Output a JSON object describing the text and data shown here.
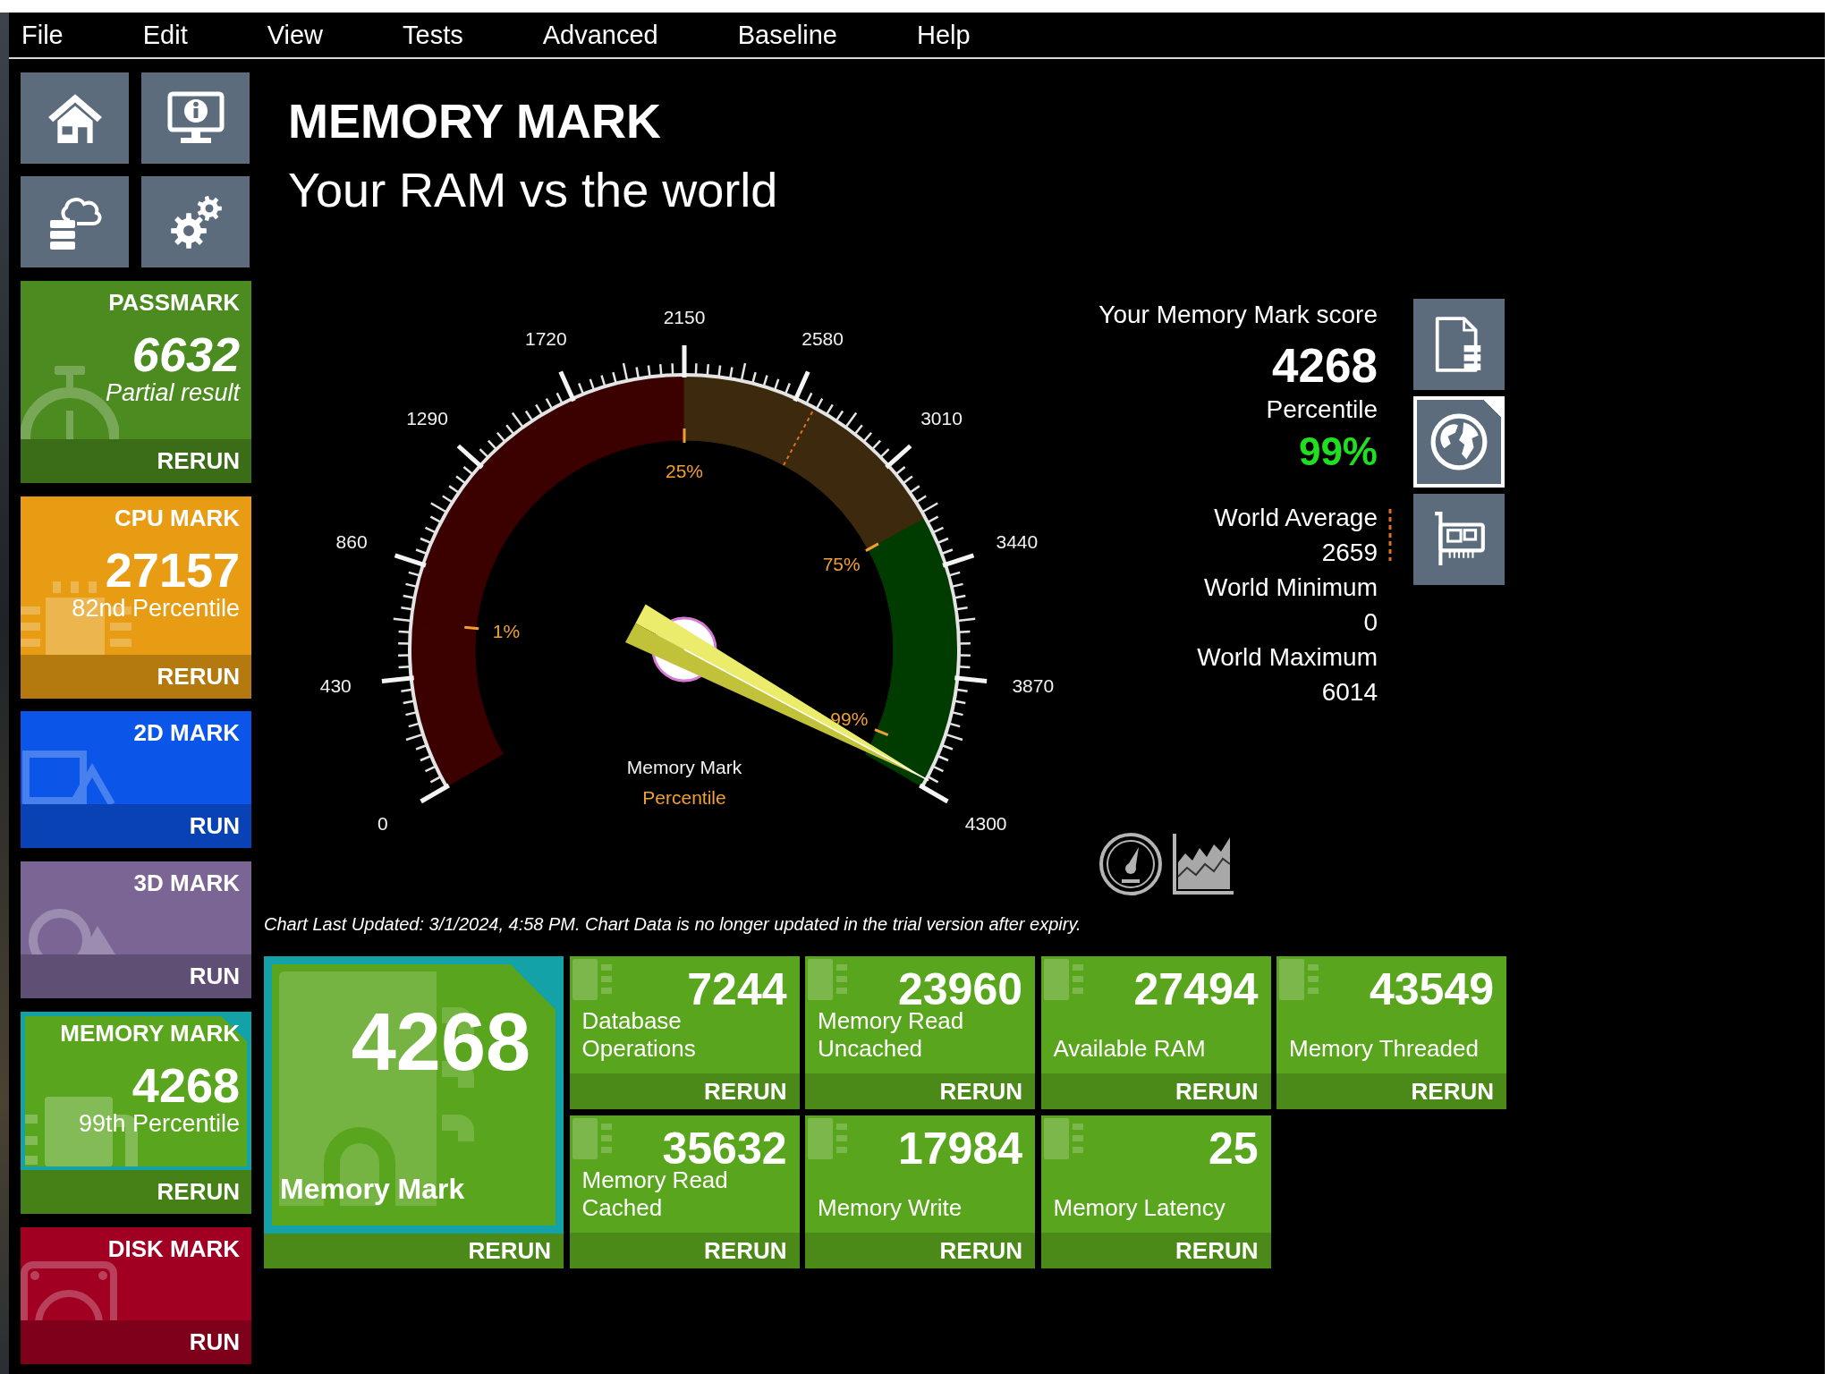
{
  "menu": [
    "File",
    "Edit",
    "View",
    "Tests",
    "Advanced",
    "Baseline",
    "Help"
  ],
  "sidebar": {
    "tiles": [
      {
        "kind": "overall",
        "title": "PASSMARK",
        "score": "6632",
        "note": "Partial result",
        "action": "RERUN",
        "color": "#4b8b1f",
        "selected": false
      },
      {
        "kind": "cpu",
        "title": "CPU MARK",
        "score": "27157",
        "note": "82nd Percentile",
        "action": "RERUN",
        "color": "#e79c13",
        "selected": false
      },
      {
        "kind": "flat",
        "title": "2D MARK",
        "action": "RUN",
        "color": "#0b55e8",
        "selected": false
      },
      {
        "kind": "solid",
        "title": "3D MARK",
        "action": "RUN",
        "color": "#7b6595",
        "selected": false
      },
      {
        "kind": "memory",
        "title": "MEMORY MARK",
        "score": "4268",
        "note": "99th Percentile",
        "action": "RERUN",
        "color": "#5aa51e",
        "selected": true
      },
      {
        "kind": "disk",
        "title": "DISK MARK",
        "action": "RUN",
        "color": "#a10022",
        "selected": false
      }
    ]
  },
  "header": {
    "title": "MEMORY MARK",
    "subtitle": "Your RAM vs the world"
  },
  "gauge": {
    "scale": [
      "0",
      "430",
      "860",
      "1290",
      "1720",
      "2150",
      "2580",
      "3010",
      "3440",
      "3870",
      "4300"
    ],
    "chart_data": [
      {
        "type": "donut",
        "title": "Memory Mark",
        "subtitle": "Percentile",
        "categories": [
          null,
          "1%",
          "25%",
          null,
          "75%",
          "99%"
        ],
        "values": [
          14.9,
          35.1,
          11.8,
          13.8,
          21.4,
          3.0
        ],
        "colors": [
          "#3b0000",
          "#3b0000",
          "#3d290d",
          "#3d290d",
          "#003c00",
          "#003c00"
        ],
        "needle": "99%"
      }
    ]
  },
  "score_panel": {
    "caption": "Your Memory Mark score",
    "score": "4268",
    "percentile_caption": "Percentile",
    "percentile": "99%",
    "stats": [
      {
        "kind": "average",
        "label": "World Average",
        "value": "2659"
      },
      {
        "kind": "plain",
        "label": "World Minimum",
        "value": "0"
      },
      {
        "kind": "plain",
        "label": "World Maximum",
        "value": "6014"
      }
    ]
  },
  "view_buttons": [
    {
      "selected": false
    },
    {
      "selected": true
    },
    {
      "selected": false
    }
  ],
  "footnote": "Chart Last Updated: 3/1/2024, 4:58 PM. Chart Data is no longer updated in the trial version after expiry.",
  "results": {
    "main": {
      "score": "4268",
      "label": "Memory Mark",
      "action": "RERUN",
      "selected": true
    },
    "tests": [
      {
        "score": "7244",
        "label": "Database Operations",
        "action": "RERUN"
      },
      {
        "score": "23960",
        "label": "Memory Read Uncached",
        "action": "RERUN"
      },
      {
        "score": "27494",
        "label": "Available RAM",
        "action": "RERUN"
      },
      {
        "score": "43549",
        "label": "Memory Threaded",
        "action": "RERUN"
      },
      {
        "score": "35632",
        "label": "Memory Read Cached",
        "action": "RERUN"
      },
      {
        "score": "17984",
        "label": "Memory Write",
        "action": "RERUN"
      },
      {
        "score": "25",
        "label": "Memory Latency",
        "action": "RERUN"
      }
    ]
  }
}
